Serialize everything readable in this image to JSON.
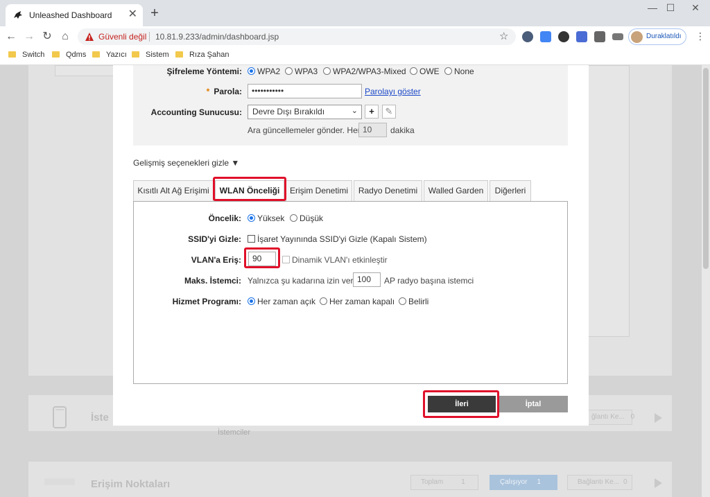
{
  "browser": {
    "tab_title": "Unleashed Dashboard",
    "tab_close": "✕",
    "new_tab": "+",
    "security_label": "Güvenli değil",
    "url": "10.81.9.233/admin/dashboard.jsp",
    "profile_label": "Duraklatıldı",
    "bookmarks": [
      "Switch",
      "Qdms",
      "Yazıcı",
      "Sistem",
      "Rıza Şahan"
    ],
    "window_controls": [
      "—",
      "☐",
      "✕"
    ]
  },
  "background": {
    "clients_title": "İste",
    "clients_sub": "İstemciler",
    "ap_title": "Erişim Noktaları",
    "clients_connected_label": "ğlantı Ke...",
    "clients_connected_value": "0",
    "ap_total_label": "Toplam",
    "ap_total_value": "1",
    "ap_running_label": "Çalışıyor",
    "ap_running_value": "1",
    "ap_connected_label": "Bağlantı Ke...",
    "ap_connected_value": "0"
  },
  "form": {
    "encryption": {
      "label": "Şifreleme Yöntemi:",
      "options": [
        "WPA2",
        "WPA3",
        "WPA2/WPA3-Mixed",
        "OWE",
        "None"
      ],
      "selected": "WPA2"
    },
    "password": {
      "required_mark": "*",
      "label": "Parola:",
      "value": "•••••••••••",
      "show_link": "Parolayı göster"
    },
    "accounting": {
      "label": "Accounting Sunucusu:",
      "value": "Devre Dışı Bırakıldı",
      "add_icon": "+",
      "edit_icon": "✎",
      "interim_prefix": "Ara güncellemeler gönder. Her",
      "interim_value": "10",
      "interim_suffix": "dakika"
    },
    "advanced_toggle": "Gelişmiş seçenekleri gizle ▼"
  },
  "tabs": [
    {
      "label": "Kısıtlı Alt Ağ Erişimi"
    },
    {
      "label": "WLAN Önceliği"
    },
    {
      "label": "Erişim Denetimi"
    },
    {
      "label": "Radyo Denetimi"
    },
    {
      "label": "Walled Garden"
    },
    {
      "label": "Diğerleri"
    }
  ],
  "wlan_priority": {
    "priority_label": "Öncelik:",
    "priority_options": [
      "Yüksek",
      "Düşük"
    ],
    "priority_selected": "Yüksek",
    "hide_ssid_label": "SSID'yi Gizle:",
    "hide_ssid_text": "İşaret Yayınında SSID'yi Gizle (Kapalı Sistem)",
    "hide_ssid_checked": false,
    "vlan_label": "VLAN'a Eriş:",
    "vlan_value": "90",
    "dynamic_vlan_text": "Dinamik VLAN'ı etkinleştir",
    "dynamic_vlan_checked": false,
    "max_clients_label": "Maks. İstemci:",
    "max_clients_prefix": "Yalnızca şu kadarına izin ver",
    "max_clients_value": "100",
    "max_clients_suffix": "AP radyo başına istemci",
    "schedule_label": "Hizmet Programı:",
    "schedule_options": [
      "Her zaman açık",
      "Her zaman kapalı",
      "Belirli"
    ],
    "schedule_selected": "Her zaman açık"
  },
  "buttons": {
    "next": "İleri",
    "cancel": "İptal"
  },
  "colors": {
    "highlight": "#e0102a",
    "radio_selected": "#1a73e8",
    "link": "#1a47c8"
  }
}
